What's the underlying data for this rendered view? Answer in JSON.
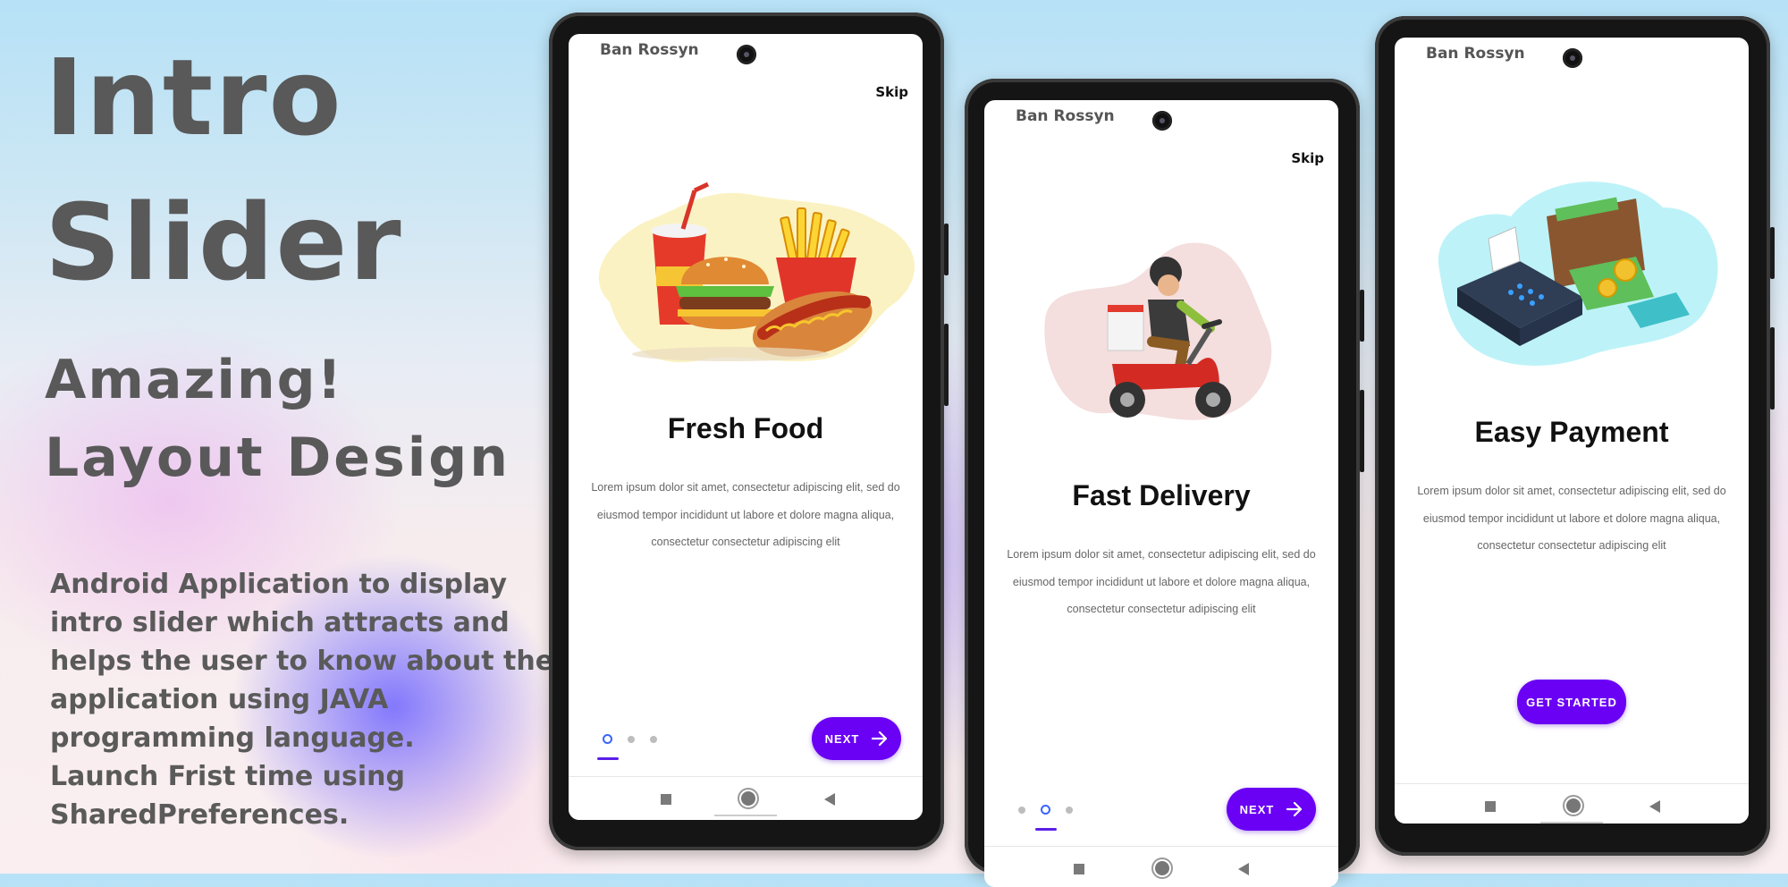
{
  "headline": {
    "line1": "Intro",
    "line2": "Slider",
    "sub1": "Amazing!",
    "sub2": "Layout  Design"
  },
  "description": [
    "Android Application to display",
    "intro slider which attracts and",
    "helps the user to know about the",
    "application using JAVA",
    "programming language.",
    "Launch Frist time using",
    "SharedPreferences."
  ],
  "screens": [
    {
      "status_name": "Ban Rossyn",
      "skip": "Skip",
      "title": "Fresh Food",
      "body": [
        "Lorem ipsum dolor sit amet, consectetur adipiscing elit, sed do",
        "eiusmod tempor incididunt ut labore et dolore magna aliqua,",
        "consectetur  consectetur adipiscing elit"
      ],
      "button": "NEXT",
      "active_dot": 1
    },
    {
      "status_name": "Ban Rossyn",
      "skip": "Skip",
      "title": "Fast Delivery",
      "body": [
        "Lorem ipsum dolor sit amet, consectetur adipiscing elit, sed do",
        "eiusmod tempor incididunt ut labore et dolore magna aliqua,",
        "consectetur  consectetur adipiscing elit"
      ],
      "button": "NEXT",
      "active_dot": 2
    },
    {
      "status_name": "Ban Rossyn",
      "title": "Easy Payment",
      "body": [
        "Lorem ipsum dolor sit amet, consectetur adipiscing elit, sed do",
        "eiusmod tempor incididunt ut labore et dolore magna aliqua,",
        "consectetur  consectetur adipiscing elit"
      ],
      "button": "GET STARTED"
    }
  ],
  "icons": {
    "next_arrow": "arrow-right-icon",
    "nav_recents": "square-icon",
    "nav_home": "circle-icon",
    "nav_back": "triangle-back-icon"
  },
  "colors": {
    "accent": "#6a00f4",
    "active_dot": "#3a64ff",
    "heading_gray": "#595959"
  }
}
